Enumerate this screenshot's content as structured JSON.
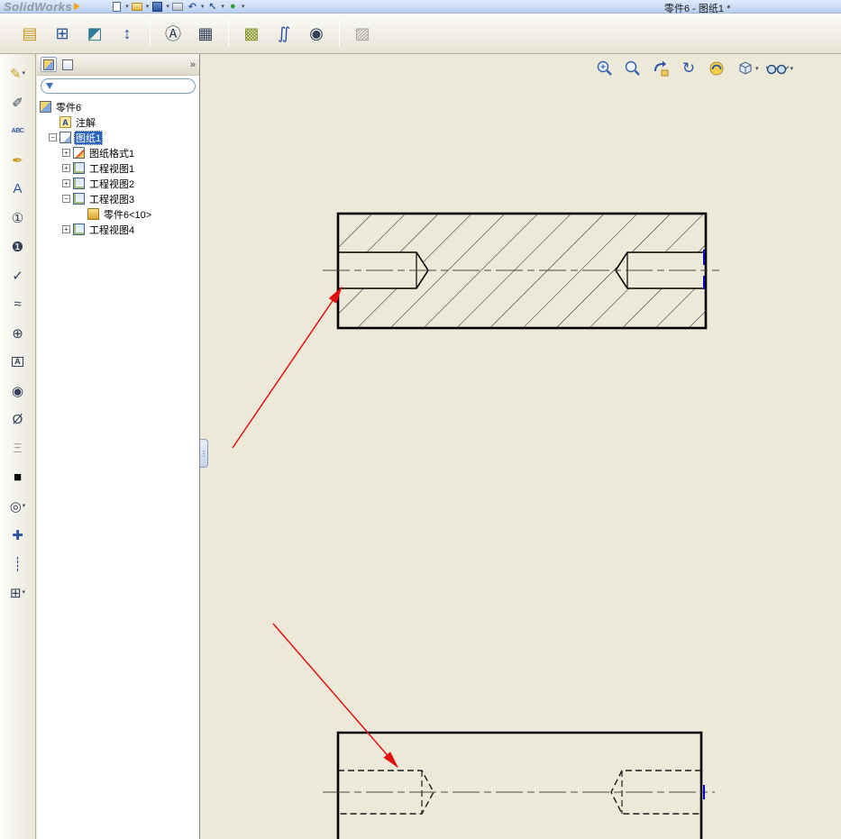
{
  "window": {
    "app_name": "SolidWorks",
    "title": "零件6 - 图纸1 *"
  },
  "panel": {
    "chevron": "»",
    "filter_value": ""
  },
  "tree": {
    "items": [
      {
        "label": "零件6"
      },
      {
        "label": "注解"
      },
      {
        "label": "图纸1",
        "expander": "−",
        "selected": true
      },
      {
        "label": "图纸格式1",
        "expander": "+"
      },
      {
        "label": "工程视图1",
        "expander": "+"
      },
      {
        "label": "工程视图2",
        "expander": "+"
      },
      {
        "label": "工程视图3",
        "expander": "−"
      },
      {
        "label": "零件6<10>"
      },
      {
        "label": "工程视图4",
        "expander": "+"
      }
    ]
  },
  "icons": {
    "caret": "▾",
    "undo": "↶",
    "cursor": "↖",
    "sphere": "●",
    "model_view": "▤",
    "projected_view": "⊞",
    "auxiliary_view": "◩",
    "section_view": "↕",
    "detail_view": "Ⓐ",
    "standard_3view": "▦",
    "broken_section": "▩",
    "break_view": "∬",
    "crop_view": "◉",
    "alt_position": "▨",
    "smart_dimension": "✎",
    "note_pencil": "✐",
    "spell_check": "ABC",
    "format_painter": "✒",
    "note_a": "A",
    "balloon": "①",
    "auto_balloon": "❶",
    "surface_finish": "✓",
    "weld": "≈",
    "gtol": "⊕",
    "datum": "A",
    "datum_target": "◉",
    "hole_callout": "Ø",
    "thread": "Ξ",
    "hatch": "■",
    "dowel": "◎",
    "center_mark": "✚",
    "centerline_tool": "┊",
    "table": "⊞",
    "rotate_view": "↻",
    "annotation_a": "A",
    "splitter_grip": "⋮"
  },
  "colors": {
    "selection": "#2f63c1",
    "canvas_bg": "#ECE9D8",
    "arrow_red": "#E01010",
    "thread_highlight": "#0000CD"
  }
}
